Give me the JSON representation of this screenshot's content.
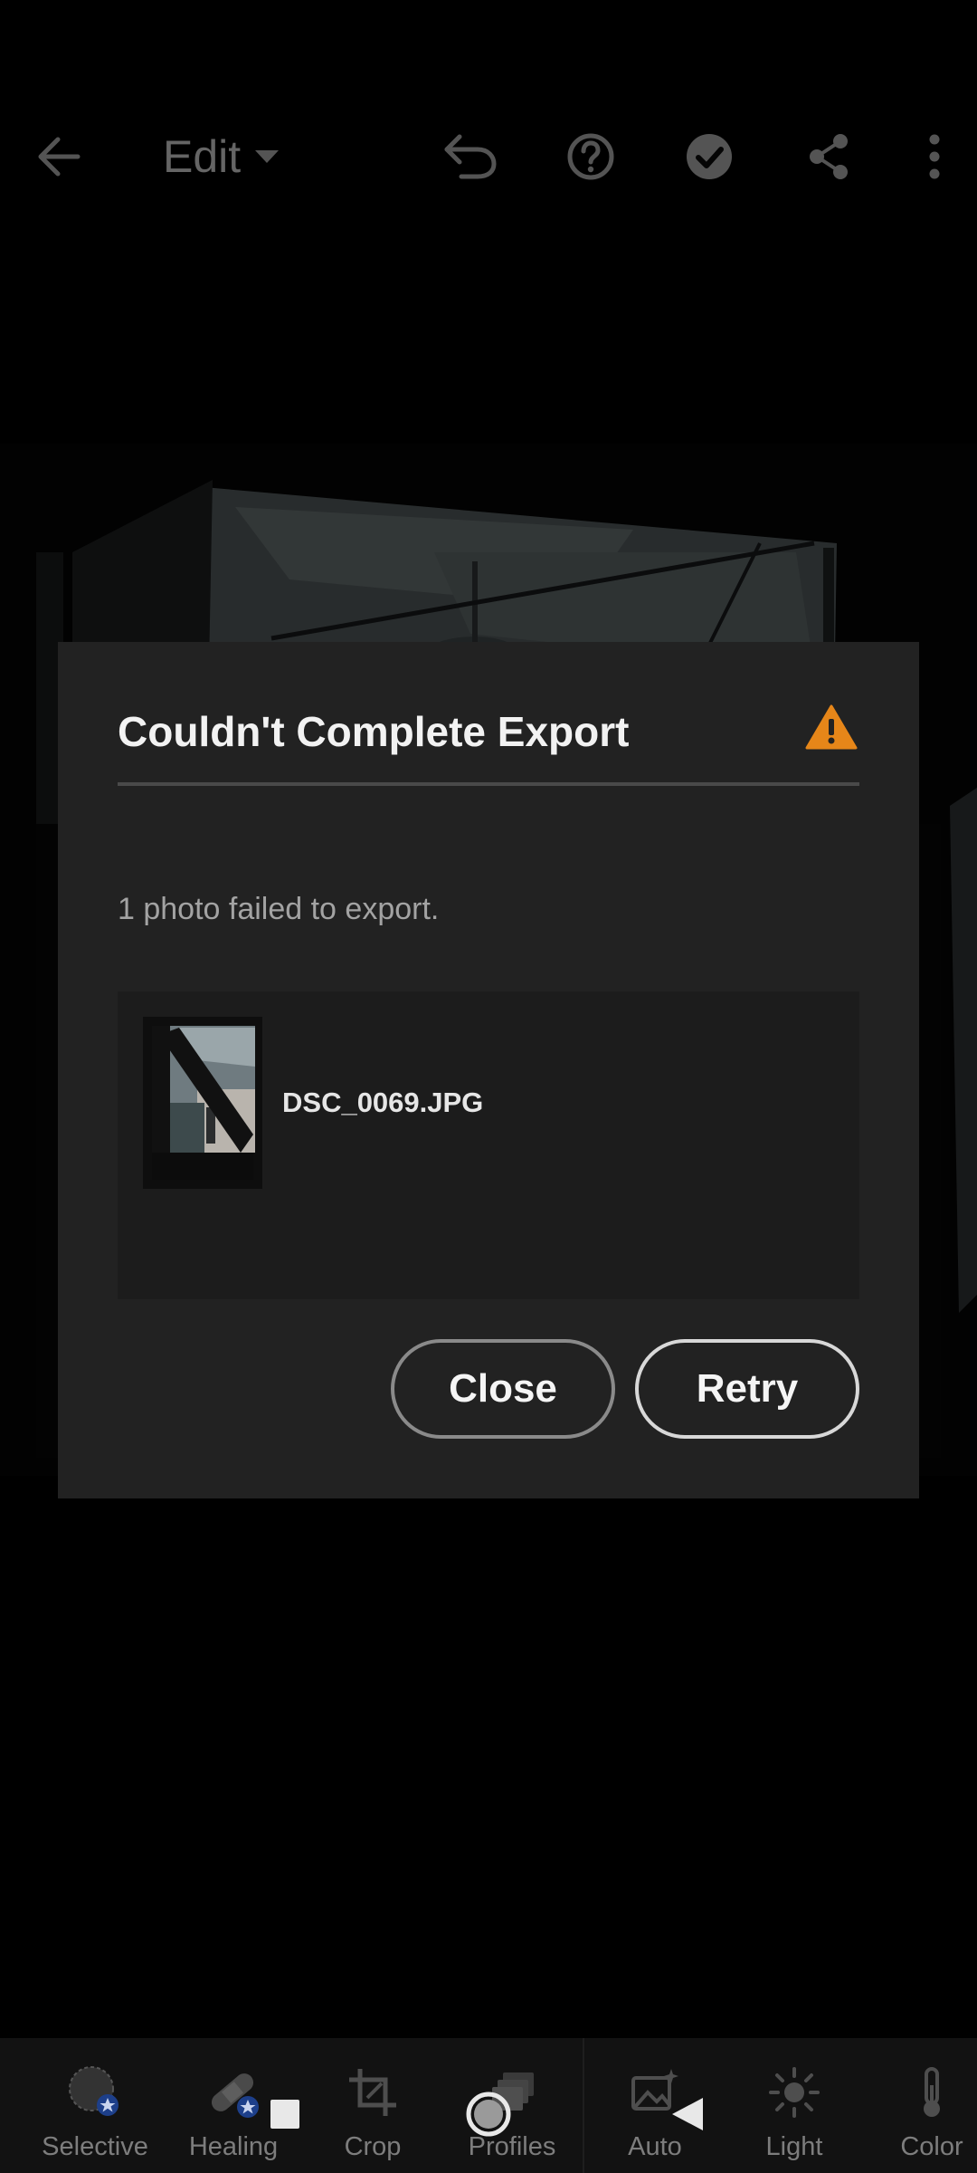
{
  "topbar": {
    "edit_label": "Edit",
    "icons": [
      "back-arrow-icon",
      "dropdown-caret-icon",
      "undo-icon",
      "help-icon",
      "done-check-icon",
      "share-icon",
      "more-options-icon"
    ]
  },
  "dialog": {
    "title": "Couldn't Complete Export",
    "warning_icon": "warning-icon",
    "warning_color": "#e68619",
    "message": "1 photo failed to export.",
    "failed_items": [
      {
        "filename": "DSC_0069.JPG"
      }
    ],
    "close_label": "Close",
    "retry_label": "Retry"
  },
  "toolbar": {
    "items": [
      {
        "label": "Selective",
        "icon": "selective-mask-icon",
        "premium": true
      },
      {
        "label": "Healing",
        "icon": "healing-bandage-icon",
        "premium": true
      },
      {
        "label": "Crop",
        "icon": "crop-icon",
        "premium": false
      },
      {
        "label": "Profiles",
        "icon": "profiles-icon",
        "premium": false
      },
      {
        "label": "Auto",
        "icon": "auto-image-icon",
        "premium": false
      },
      {
        "label": "Light",
        "icon": "light-sun-icon",
        "premium": false
      },
      {
        "label": "Color",
        "icon": "color-thermometer-icon",
        "premium": false
      }
    ]
  },
  "system_nav": {
    "icons": [
      "recents-square-icon",
      "home-circle-icon",
      "back-triangle-icon"
    ]
  }
}
